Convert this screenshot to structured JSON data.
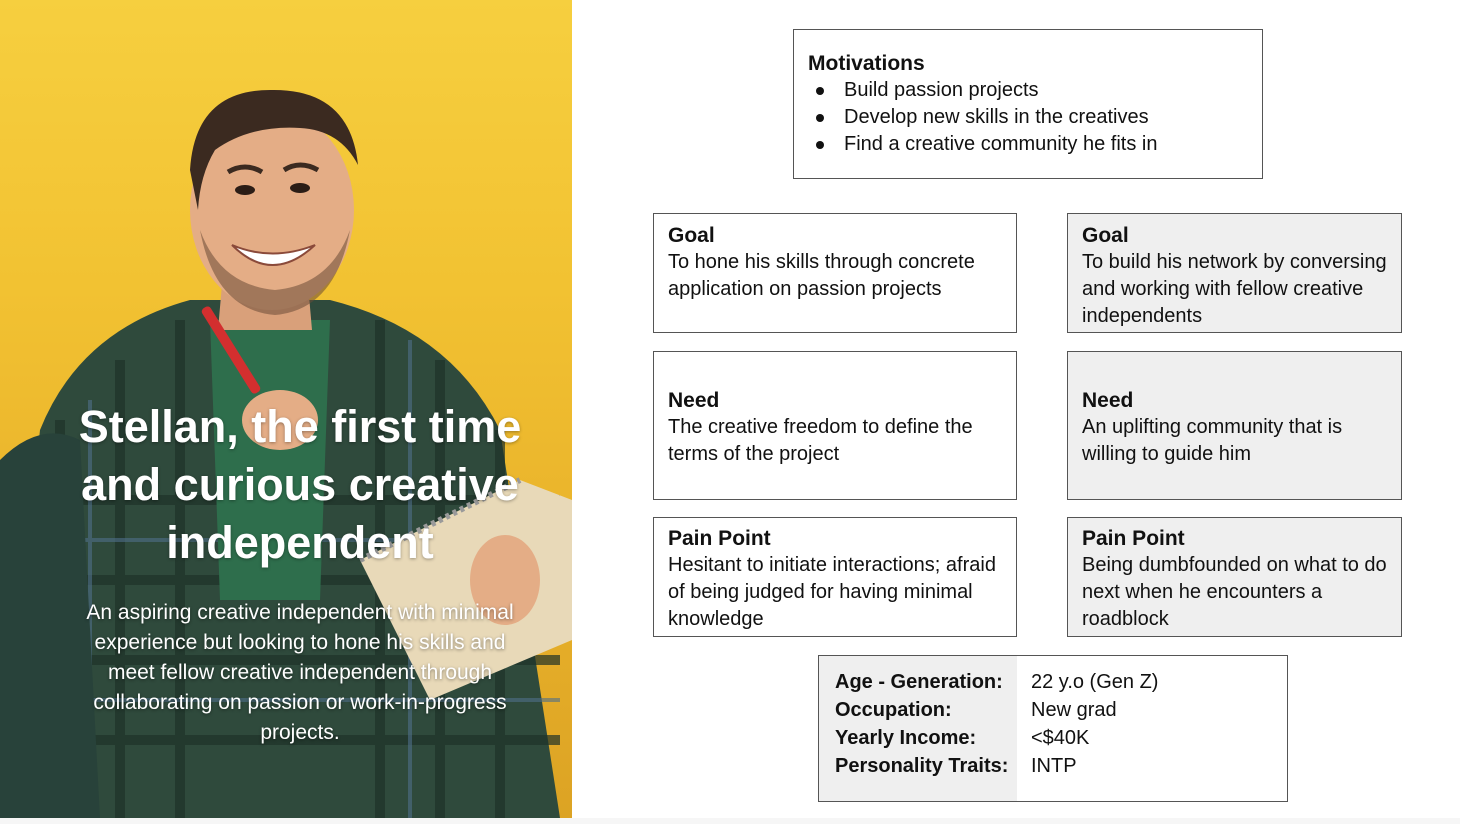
{
  "hero": {
    "title": "Stellan, the first time and curious creative independent",
    "description": "An aspiring creative independent with minimal experience but looking to hone his skills and meet fellow creative independent through collaborating on passion or work-in-progress projects."
  },
  "motivations": {
    "title": "Motivations",
    "items": [
      "Build passion projects",
      "Develop new skills in the creatives",
      "Find a creative community he fits in"
    ]
  },
  "cards": {
    "goal_1": {
      "title": "Goal",
      "body": "To hone his skills through concrete application on passion projects"
    },
    "goal_2": {
      "title": "Goal",
      "body": "To build his network by conversing and working with fellow creative independents"
    },
    "need_1": {
      "title": "Need",
      "body": "The creative freedom to define the terms of the project"
    },
    "need_2": {
      "title": "Need",
      "body": "An uplifting community that is willing to guide him"
    },
    "pain_1": {
      "title": "Pain Point",
      "body": "Hesitant to initiate interactions; afraid of being judged for having minimal knowledge"
    },
    "pain_2": {
      "title": "Pain Point",
      "body": "Being dumbfounded on what to do next when he encounters a roadblock"
    }
  },
  "demographics": {
    "labels": [
      "Age - Generation:",
      "Occupation:",
      "Yearly Income:",
      "Personality Traits:"
    ],
    "values": [
      "22 y.o (Gen Z)",
      "New grad",
      "<$40K",
      "INTP"
    ]
  },
  "colors": {
    "hero_yellow": "#f2c232",
    "card_gray": "#efefef",
    "border": "#555555"
  }
}
